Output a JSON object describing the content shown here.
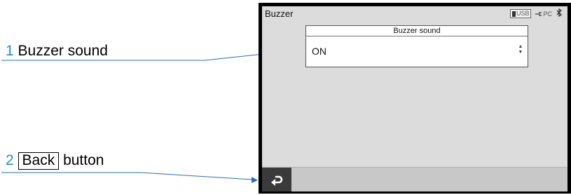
{
  "callouts": [
    {
      "number": "1",
      "label": "Buzzer sound"
    },
    {
      "number": "2",
      "label": "Back",
      "suffix": "button"
    }
  ],
  "screen": {
    "title": "Buzzer",
    "status": {
      "usb_label": "USB",
      "pc_label": "PC",
      "icons": [
        "usb-icon",
        "pc-connection-icon",
        "bluetooth-icon"
      ]
    },
    "buzzer_sound": {
      "header": "Buzzer sound",
      "value": "ON",
      "control_icon": "up-down-spinner-icon"
    },
    "bottom_bar": {
      "back_icon": "back-arrow-icon"
    }
  },
  "colors": {
    "callout_number": "#1f8fc8",
    "leader_line": "#2a6fb4",
    "screen_bg": "#dcdcdc",
    "bottom_bar": "#c8c8c8",
    "back_button": "#3a3a3a"
  }
}
